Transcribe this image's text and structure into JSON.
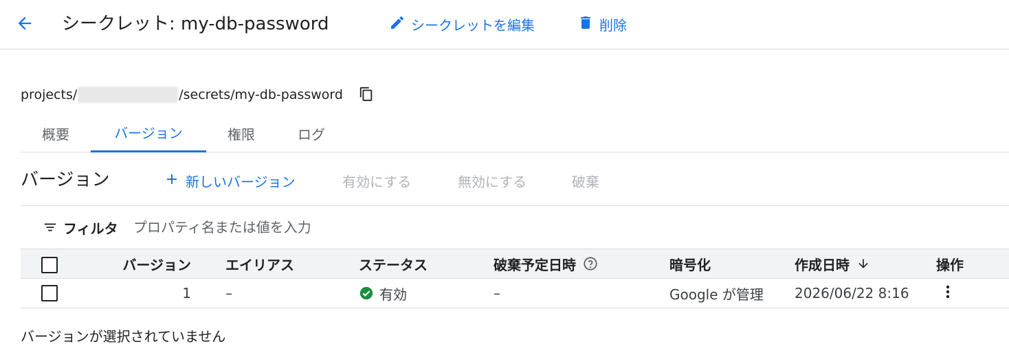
{
  "header": {
    "title": "シークレット: my-db-password",
    "edit_label": "シークレットを編集",
    "delete_label": "削除",
    "back_icon": "arrow-back-icon",
    "edit_icon": "pencil-icon",
    "delete_icon": "trash-icon"
  },
  "resource_path": {
    "prefix": "projects/",
    "suffix": "/secrets/my-db-password",
    "copy_icon": "copy-icon"
  },
  "tabs": [
    {
      "label": "概要",
      "active": false
    },
    {
      "label": "バージョン",
      "active": true
    },
    {
      "label": "権限",
      "active": false
    },
    {
      "label": "ログ",
      "active": false
    }
  ],
  "section": {
    "title": "バージョン",
    "new_version_label": "新しいバージョン",
    "enable_label": "有効にする",
    "disable_label": "無効にする",
    "destroy_label": "破棄"
  },
  "filter": {
    "label": "フィルタ",
    "placeholder": "プロパティ名または値を入力",
    "value": ""
  },
  "table": {
    "columns": {
      "version": "バージョン",
      "alias": "エイリアス",
      "status": "ステータス",
      "scheduled_destroy": "破棄予定日時",
      "encryption": "暗号化",
      "created": "作成日時",
      "actions": "操作"
    },
    "rows": [
      {
        "version": "1",
        "alias": "–",
        "status": "有効",
        "scheduled_destroy": "–",
        "encryption": "Google が管理",
        "created": "2026/06/22 8:16"
      }
    ]
  },
  "selection_message": "バージョンが選択されていません",
  "colors": {
    "accent": "#1a73e8",
    "disabled": "#b0b3b8",
    "success": "#1e8e3e",
    "border": "#dadce0",
    "header_bg": "#f1f3f4"
  }
}
